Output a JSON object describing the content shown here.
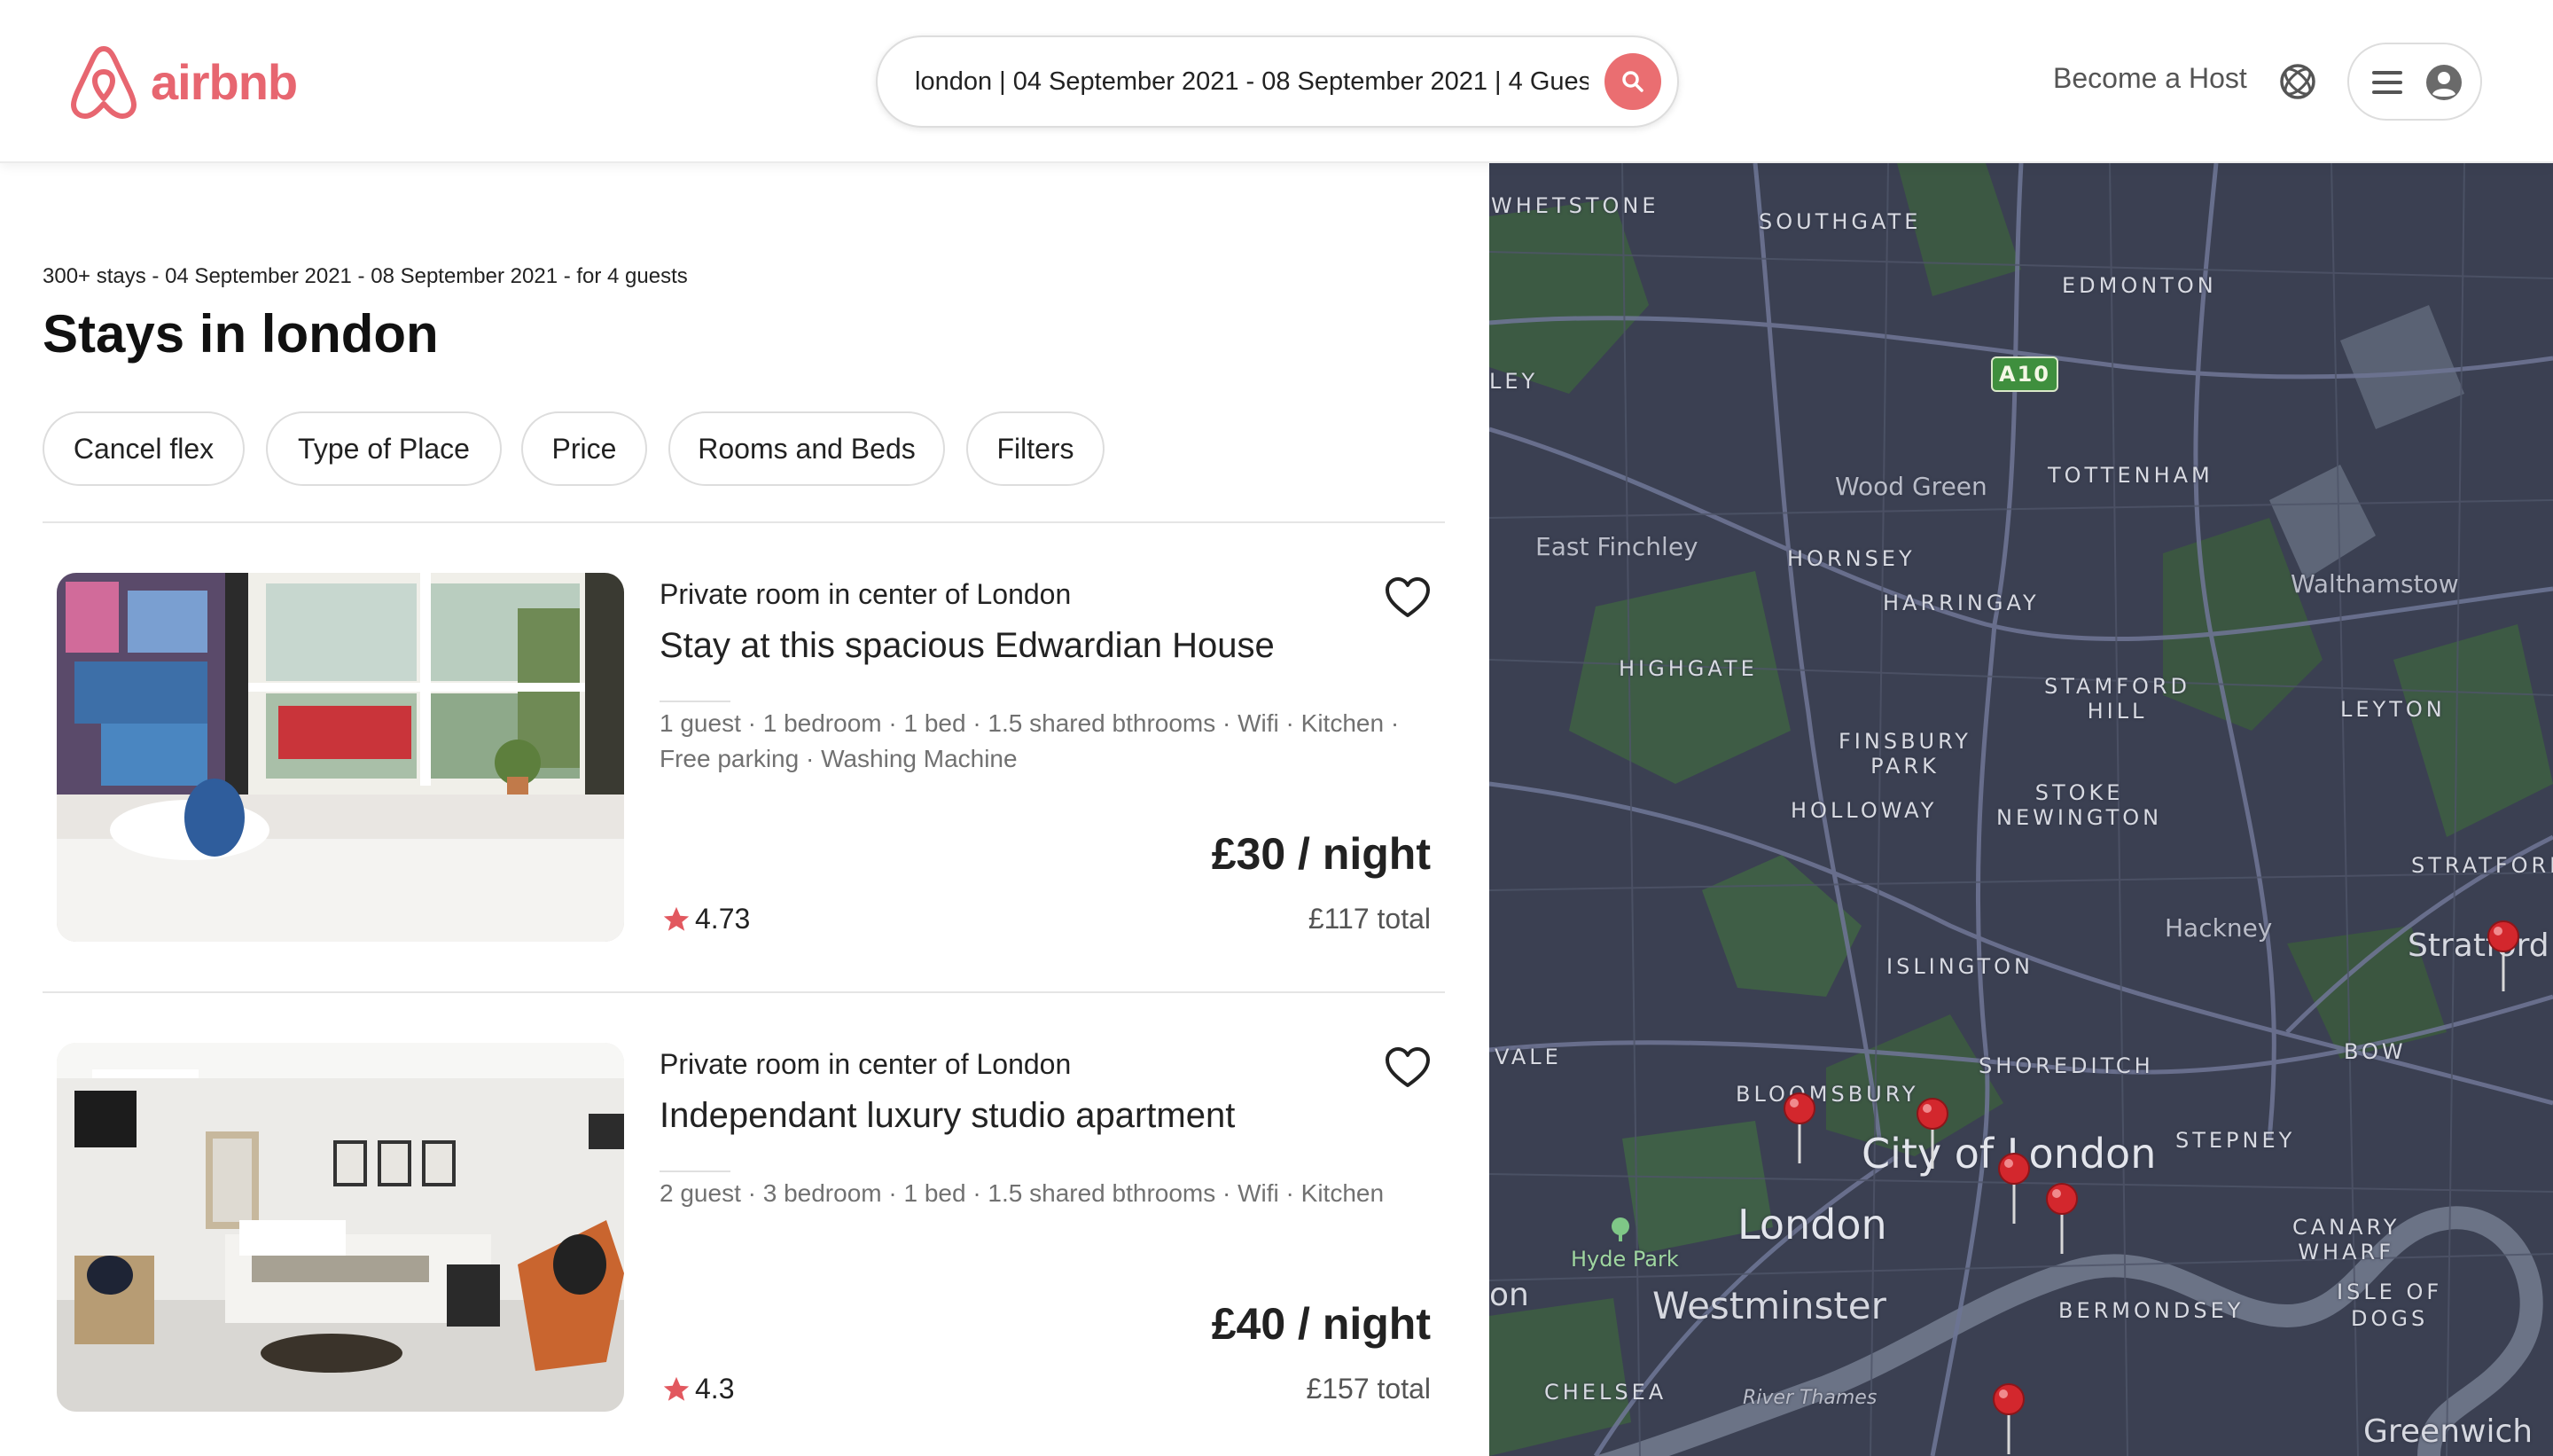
{
  "header": {
    "logo_text": "airbnb",
    "search_text": "london | 04 September 2021 - 08 September 2021 | 4 Gues",
    "become_host": "Become a Host",
    "brand_color": "#E76670"
  },
  "results": {
    "subheading": "300+ stays - 04 September 2021 - 08 September 2021 - for 4 guests",
    "title": "Stays in london"
  },
  "filters": [
    "Cancel flex",
    "Type of Place",
    "Price",
    "Rooms and Beds",
    "Filters"
  ],
  "listings": [
    {
      "type": "Private room in center of London",
      "title": "Stay at this spacious Edwardian House",
      "amenities": "1 guest · 1 bedroom · 1 bed · 1.5 shared bthrooms · Wifi · Kitchen · Free parking · Washing Machine",
      "price": "£30 / night",
      "total": "£117 total",
      "rating": "4.73"
    },
    {
      "type": "Private room in center of London",
      "title": "Independant luxury studio apartment",
      "amenities": "2 guest · 3 bedroom · 1 bed · 1.5 shared bthrooms · Wifi · Kitchen",
      "price": "£40 / night",
      "total": "£157 total",
      "rating": "4.3"
    }
  ],
  "map": {
    "road_badge": "A10",
    "labels": {
      "whetstone": "WHETSTONE",
      "southgate": "SOUTHGATE",
      "edmonton": "EDMONTON",
      "ley": "LEY",
      "wood_green": "Wood Green",
      "tottenham": "TOTTENHAM",
      "east_finchley": "East Finchley",
      "hornsey": "HORNSEY",
      "harringay": "HARRINGAY",
      "walthamstow": "Walthamstow",
      "highgate": "HIGHGATE",
      "stamford_hill": "STAMFORD\nHILL",
      "leyton": "LEYTON",
      "finsbury_park": "FINSBURY\nPARK",
      "holloway": "HOLLOWAY",
      "stoke_newington": "STOKE\nNEWINGTON",
      "stratford_caps": "STRATFORD",
      "hackney": "Hackney",
      "stratford": "Stratford",
      "islington": "ISLINGTON",
      "vale": "VALE",
      "shoreditch": "SHOREDITCH",
      "bow": "BOW",
      "bloomsbury": "BLOOMSBURY",
      "city_of_london": "City of London",
      "stepney": "STEPNEY",
      "london": "London",
      "hyde_park": "Hyde Park",
      "canary_wharf": "CANARY\nWHARF",
      "on": "on",
      "westminster": "Westminster",
      "bermondsey": "BERMONDSEY",
      "isle_of_dogs": "ISLE OF\nDOGS",
      "chelsea": "CHELSEA",
      "river_thames": "River Thames",
      "greenwich": "Greenwich"
    }
  }
}
